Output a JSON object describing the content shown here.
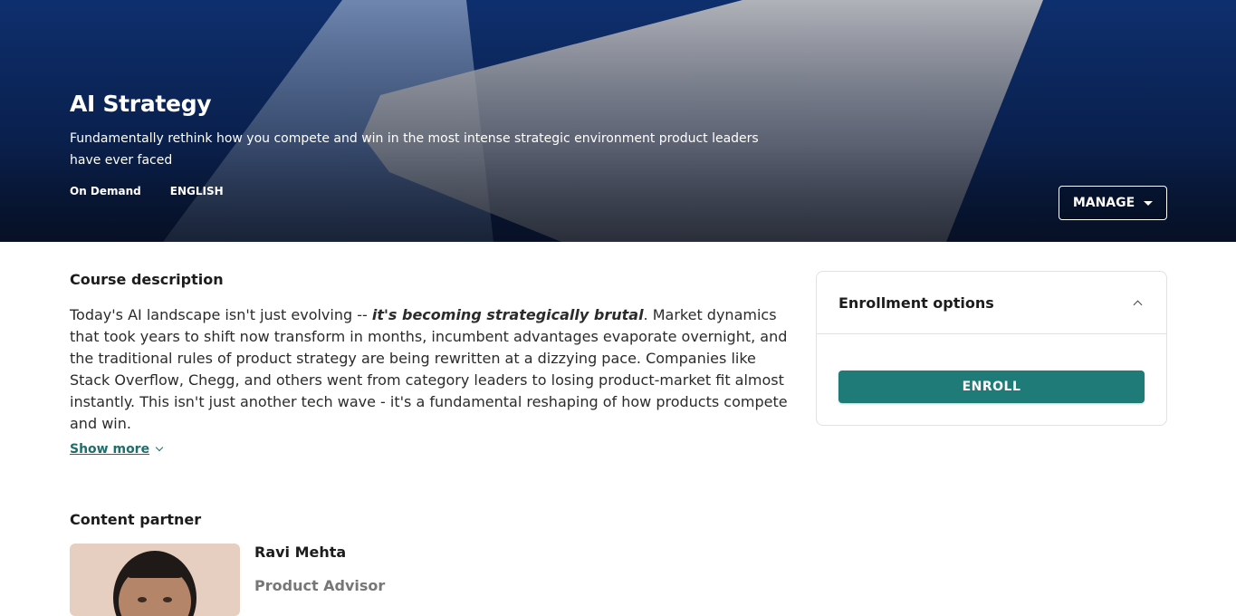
{
  "hero": {
    "title": "AI Strategy",
    "subtitle": "Fundamentally rethink how you compete and win in the most intense strategic environment product leaders have ever faced",
    "format": "On Demand",
    "language": "ENGLISH",
    "manage_label": "MANAGE"
  },
  "description": {
    "heading": "Course description",
    "text_before": "Today's AI landscape isn't just evolving -- ",
    "emphasis": "it's becoming strategically brutal",
    "text_after": ". Market dynamics that took years to shift now transform in months, incumbent advantages evaporate overnight, and the traditional rules of product strategy are being rewritten at a dizzying pace. Companies like Stack Overflow, Chegg, and others went from category leaders to losing product-market fit almost instantly. This isn't just another tech wave - it's a fundamental reshaping of how products compete and win.",
    "show_more_label": "Show more"
  },
  "enrollment": {
    "title": "Enrollment options",
    "enroll_label": "ENROLL"
  },
  "partner": {
    "heading": "Content partner",
    "name": "Ravi Mehta",
    "role": "Product Advisor"
  },
  "colors": {
    "hero_bg": "#0b2559",
    "accent": "#1e7b78"
  }
}
